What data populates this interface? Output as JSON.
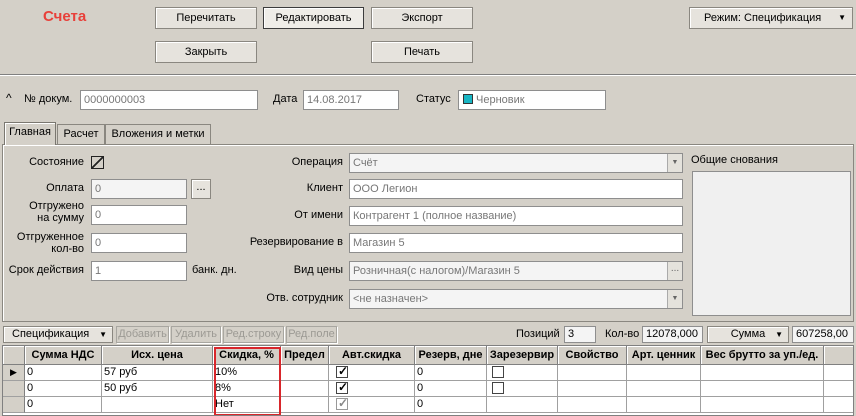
{
  "header": {
    "title": "Счета",
    "buttons": {
      "reread": "Перечитать",
      "edit": "Редактировать",
      "export": "Экспорт",
      "close": "Закрыть",
      "print": "Печать"
    },
    "mode_dropdown": "Режим: Спецификация"
  },
  "doc": {
    "num_label": "№ докум.",
    "num_value": "0000000003",
    "date_label": "Дата",
    "date_value": "14.08.2017",
    "status_label": "Статус",
    "status_value": "Черновик"
  },
  "tabs": [
    "Главная",
    "Расчет",
    "Вложения и метки"
  ],
  "main": {
    "state_label": "Состояние",
    "payment_label": "Оплата",
    "payment_value": "0",
    "shipped_sum_label_1": "Отгружено",
    "shipped_sum_label_2": "на сумму",
    "shipped_sum_value": "0",
    "shipped_qty_label_1": "Отгруженное",
    "shipped_qty_label_2": "кол-во",
    "shipped_qty_value": "0",
    "validity_label": "Срок действия",
    "validity_value": "1",
    "validity_unit": "банк. дн.",
    "operation_label": "Операция",
    "operation_value": "Счёт",
    "client_label": "Клиент",
    "client_value": "ООО Легион",
    "on_behalf_label": "От имени",
    "on_behalf_value": "Контрагент 1 (полное название)",
    "reserve_label": "Резервирование в",
    "reserve_value": "Магазин 5",
    "price_type_label": "Вид цены",
    "price_type_value": "Розничная(с налогом)/Магазин 5",
    "employee_label": "Отв. сотрудник",
    "employee_value": "<не назначен>",
    "general_grounds_label": "Общие снования",
    "ellipsis": "..."
  },
  "toolbar": {
    "spec_dropdown": "Спецификация",
    "add": "Добавить",
    "delete": "Удалить",
    "edit_row": "Ред.строку",
    "edit_field": "Ред.поле",
    "positions_label": "Позиций",
    "positions_value": "3",
    "qty_label": "Кол-во",
    "qty_value": "12078,000",
    "sum_dropdown": "Сумма",
    "sum_value": "607258,00"
  },
  "grid": {
    "columns": [
      "Сумма НДС",
      "Исх. цена",
      "Скидка, %",
      "Предел",
      "Авт.скидка",
      "Резерв, дне",
      "Зарезервир",
      "Свойство",
      "Арт. ценник",
      "Вес брутто за уп./ед."
    ],
    "rows": [
      {
        "vat": "0",
        "price": "57 руб",
        "discount": "10%",
        "limit": "",
        "auto": true,
        "reserve": "0",
        "reserved": false
      },
      {
        "vat": "0",
        "price": "50 руб",
        "discount": "8%",
        "limit": "",
        "auto": true,
        "reserve": "0",
        "reserved": false
      },
      {
        "vat": "0",
        "price": "",
        "discount": "Нет",
        "limit": "",
        "auto": true,
        "reserve": "0",
        "reserved": false
      }
    ]
  },
  "colors": {
    "title_red": "#e8403a",
    "highlight_red": "#d8262b",
    "status_teal": "#18b6c4"
  }
}
